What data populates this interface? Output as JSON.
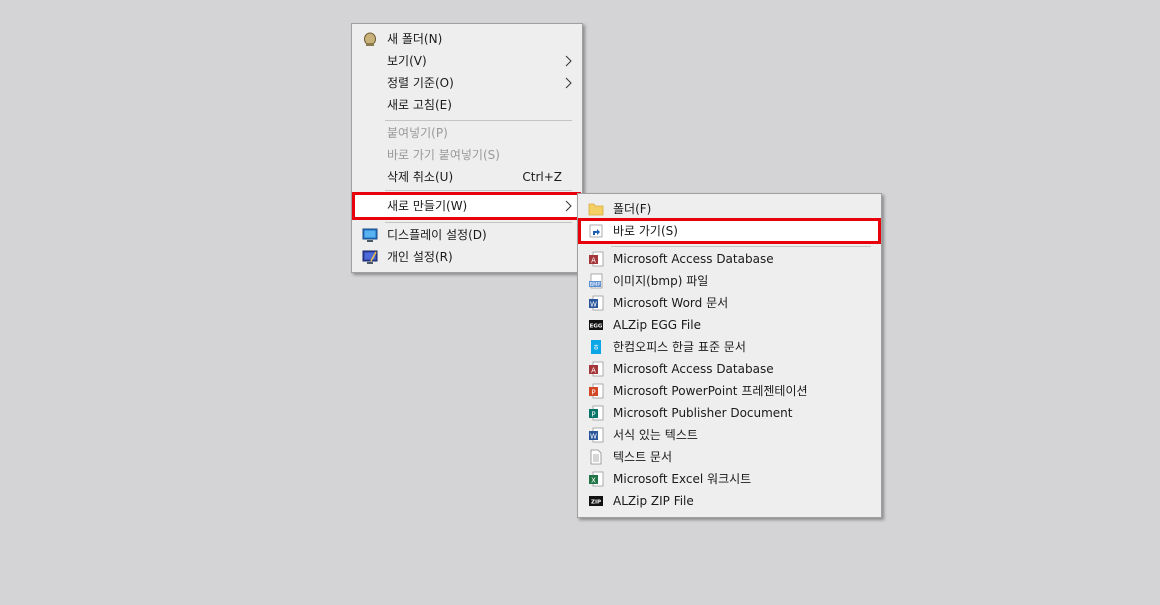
{
  "main_menu": {
    "items": [
      {
        "label": "새 폴더(N)"
      },
      {
        "label": "보기(V)"
      },
      {
        "label": "정렬 기준(O)"
      },
      {
        "label": "새로 고침(E)"
      },
      {
        "label": "붙여넣기(P)"
      },
      {
        "label": "바로 가기 붙여넣기(S)"
      },
      {
        "label": "삭제 취소(U)",
        "shortcut": "Ctrl+Z"
      },
      {
        "label": "새로 만들기(W)"
      },
      {
        "label": "디스플레이 설정(D)"
      },
      {
        "label": "개인 설정(R)"
      }
    ]
  },
  "sub_menu": {
    "items": [
      {
        "label": "폴더(F)",
        "icon": "folder-icon"
      },
      {
        "label": "바로 가기(S)",
        "icon": "shortcut-icon"
      },
      {
        "label": "Microsoft Access Database",
        "icon": "access-icon"
      },
      {
        "label": "이미지(bmp) 파일",
        "icon": "bmp-icon"
      },
      {
        "label": "Microsoft Word 문서",
        "icon": "word-icon"
      },
      {
        "label": "ALZip EGG File",
        "icon": "egg-icon"
      },
      {
        "label": "한컴오피스 한글 표준 문서",
        "icon": "hwp-icon"
      },
      {
        "label": "Microsoft Access Database",
        "icon": "access-icon"
      },
      {
        "label": "Microsoft PowerPoint 프레젠테이션",
        "icon": "powerpoint-icon"
      },
      {
        "label": "Microsoft Publisher Document",
        "icon": "publisher-icon"
      },
      {
        "label": "서식 있는 텍스트",
        "icon": "rtf-icon"
      },
      {
        "label": "텍스트 문서",
        "icon": "text-icon"
      },
      {
        "label": "Microsoft Excel 워크시트",
        "icon": "excel-icon"
      },
      {
        "label": "ALZip ZIP File",
        "icon": "zip-icon"
      }
    ]
  },
  "colors": {
    "desktop": "#d4d4d6",
    "menu_bg": "#eeeeee",
    "highlight_border": "#e8000b",
    "disabled_text": "#9a9a9a"
  }
}
